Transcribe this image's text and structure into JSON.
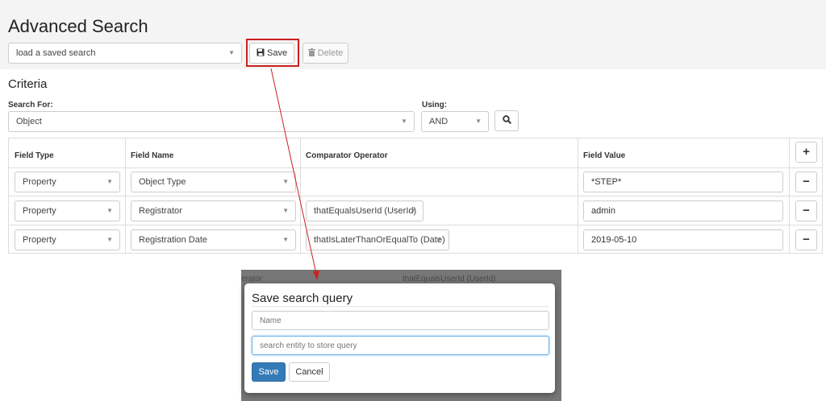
{
  "header": {
    "title": "Advanced Search",
    "saved_search_select": "load a saved search",
    "save_label": "Save",
    "delete_label": "Delete"
  },
  "criteria": {
    "title": "Criteria",
    "search_for_label": "Search For:",
    "search_for_value": "Object",
    "using_label": "Using:",
    "using_value": "AND"
  },
  "table": {
    "headers": {
      "field_type": "Field Type",
      "field_name": "Field Name",
      "comparator": "Comparator Operator",
      "field_value": "Field Value"
    },
    "rows": [
      {
        "field_type": "Property",
        "field_name": "Object Type",
        "comparator": "",
        "value": "*STEP*"
      },
      {
        "field_type": "Property",
        "field_name": "Registrator",
        "comparator": "thatEqualsUserId (UserId)",
        "value": "admin"
      },
      {
        "field_type": "Property",
        "field_name": "Registration Date",
        "comparator": "thatIsLaterThanOrEqualTo (Date)",
        "value": "2019-05-10"
      }
    ]
  },
  "background_fragments": {
    "operator": "erator",
    "comparator": "thatEqualsUserId (UserId)"
  },
  "modal": {
    "title": "Save search query",
    "name_placeholder": "Name",
    "entity_placeholder": "search entity to store query",
    "save_label": "Save",
    "cancel_label": "Cancel"
  },
  "colors": {
    "highlight": "#cc1f1f",
    "primary": "#337ab7",
    "focus": "#66afe9",
    "overlay": "#777777"
  },
  "icons": {
    "save": "floppy-disk-icon",
    "delete": "trash-icon",
    "search": "magnifier-icon",
    "add": "plus-icon",
    "remove": "minus-icon"
  }
}
